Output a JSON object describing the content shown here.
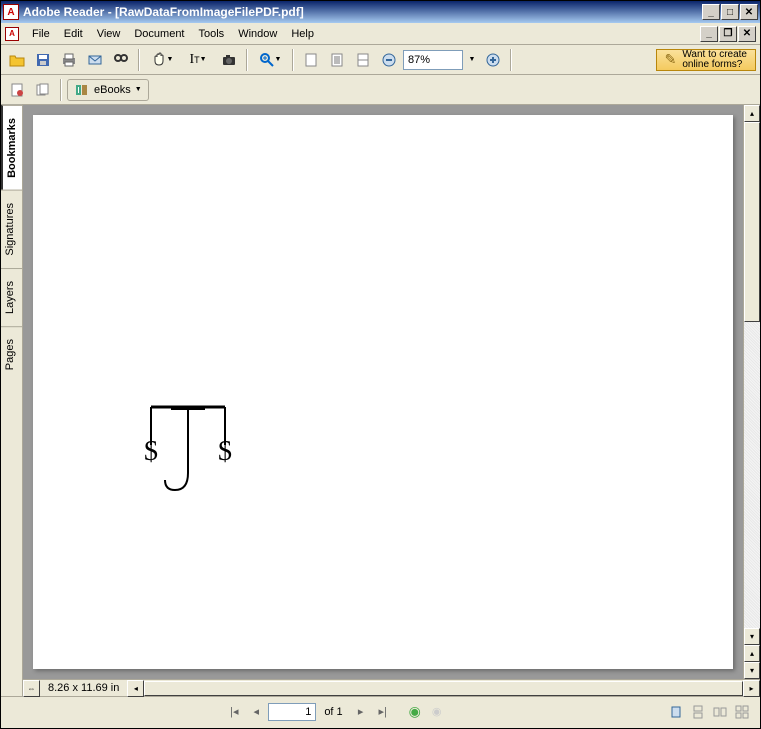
{
  "window": {
    "app": "Adobe Reader",
    "doc": "[RawDataFromImageFilePDF.pdf]"
  },
  "menu": {
    "file": "File",
    "edit": "Edit",
    "view": "View",
    "document": "Document",
    "tools": "Tools",
    "window": "Window",
    "help": "Help"
  },
  "toolbar": {
    "zoom": "87%",
    "promo_line1": "Want to create",
    "promo_line2": "online forms?",
    "ebooks": "eBooks"
  },
  "sidetabs": {
    "bookmarks": "Bookmarks",
    "signatures": "Signatures",
    "layers": "Layers",
    "pages": "Pages"
  },
  "status": {
    "dimensions": "8.26 x 11.69 in",
    "page_current": "1",
    "page_total": "of 1"
  }
}
